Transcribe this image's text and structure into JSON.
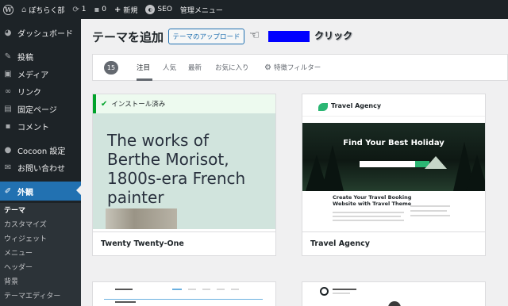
{
  "admin_bar": {
    "site_name": "ぽちらく部",
    "updates_count": "1",
    "comments_count": "0",
    "new_label": "新規",
    "seo_label": "SEO",
    "admin_menu_label": "管理メニュー"
  },
  "sidebar": {
    "items": [
      {
        "label": "ダッシュボード",
        "icon": "dashboard-icon"
      },
      {
        "label": "投稿",
        "icon": "pin-icon"
      },
      {
        "label": "メディア",
        "icon": "media-icon"
      },
      {
        "label": "リンク",
        "icon": "link-icon"
      },
      {
        "label": "固定ページ",
        "icon": "page-icon"
      },
      {
        "label": "コメント",
        "icon": "comment-icon"
      },
      {
        "label": "Cocoon 設定",
        "icon": "cocoon-icon"
      },
      {
        "label": "お問い合わせ",
        "icon": "mail-icon"
      },
      {
        "label": "外観",
        "icon": "brush-icon"
      }
    ],
    "submenu": [
      "テーマ",
      "カスタマイズ",
      "ウィジェット",
      "メニュー",
      "ヘッダー",
      "背景",
      "テーマエディター"
    ]
  },
  "main": {
    "title": "テーマを追加",
    "upload_button": "テーマのアップロード",
    "annotation": "クリック",
    "filter": {
      "count": "15",
      "tabs": [
        "注目",
        "人気",
        "最新",
        "お気に入り"
      ],
      "feature_filter": "特徴フィルター"
    },
    "themes": [
      {
        "name": "Twenty Twenty-One",
        "installed_label": "インストール済み",
        "preview_text": "The works of Berthe Morisot, 1800s-era French painter"
      },
      {
        "name": "Travel Agency",
        "preview_logo": "Travel Agency",
        "preview_hero": "Find Your Best Holiday",
        "preview_heading": "Create Your Travel Booking Website with Travel Theme"
      }
    ]
  },
  "colors": {
    "admin_dark": "#1d2327",
    "accent_blue": "#2271b1",
    "installed_green": "#00a32a",
    "annotation_blue": "#0000ff"
  }
}
